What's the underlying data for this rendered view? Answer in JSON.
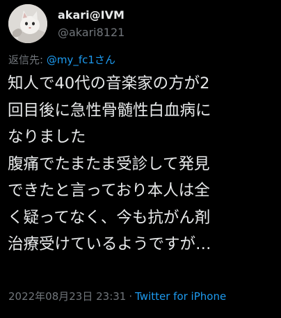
{
  "user": {
    "display_name": "akari@IVM",
    "handle": "@akari8121"
  },
  "reply": {
    "prefix": "返信先:",
    "mention": "@my_fc1さん"
  },
  "tweet": {
    "lines": [
      "知人で40代の音楽家の方が2",
      "回目後に急性骨髄性白血病に",
      "なりました",
      "腹痛でたまたま受診して発見",
      "できたと言っており本人は全",
      "く疑ってなく、今も抗がん剤",
      "治療受けているようですが…"
    ]
  },
  "meta": {
    "timestamp": "2022年08月23日 23:31",
    "separator": "·",
    "source": "Twitter for iPhone"
  },
  "colors": {
    "background": "#000000",
    "text": "#e7e9ea",
    "muted": "#71767b",
    "accent": "#1d9bf0"
  },
  "icons": {
    "avatar": "cat-avatar"
  }
}
